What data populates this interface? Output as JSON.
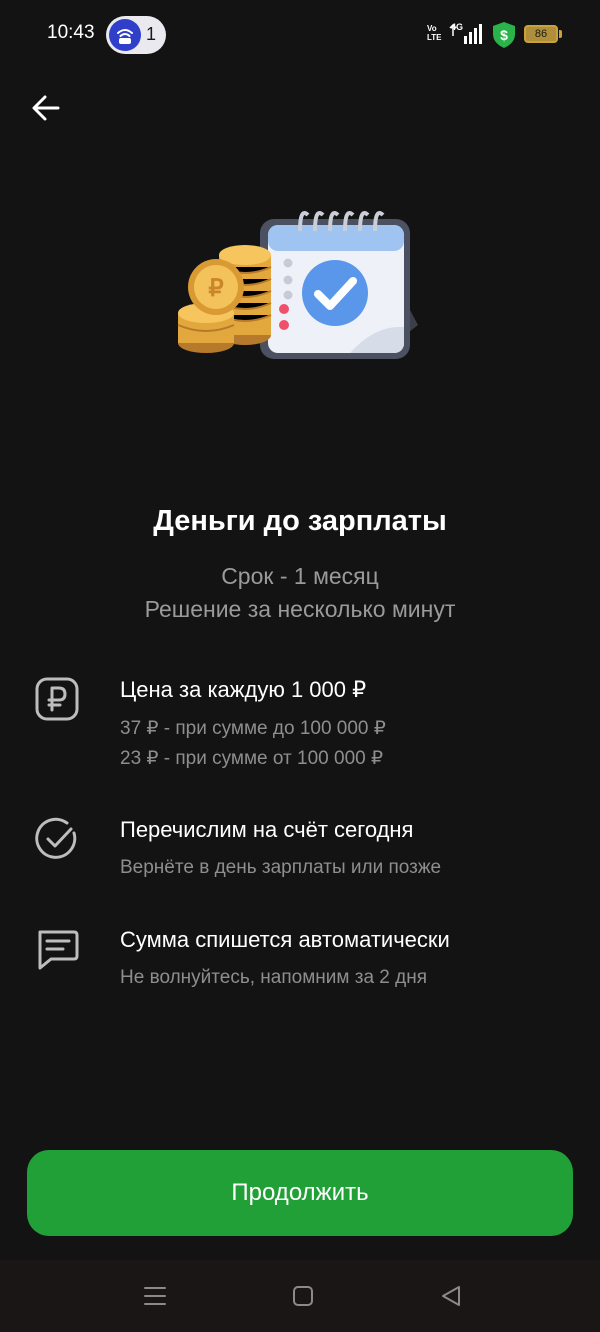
{
  "status_bar": {
    "time": "10:43",
    "vpn_count": "1",
    "volte": "Vo LTE",
    "network": "4G",
    "battery": "86"
  },
  "colors": {
    "background": "#131313",
    "accent_green": "#21a038",
    "muted_text": "#8e8e8e"
  },
  "header": {
    "back_icon": "arrow-left-icon"
  },
  "hero": {
    "illustration": "coins-and-calendar-checkmark"
  },
  "title": "Деньги до зарплаты",
  "subtitle": [
    "Срок - 1 месяц",
    "Решение за несколько минут"
  ],
  "features": [
    {
      "icon": "ruble-icon",
      "title": "Цена за каждую 1 000 ₽",
      "lines": [
        "37 ₽ - при сумме до 100 000 ₽",
        "23 ₽ - при сумме от 100 000 ₽"
      ]
    },
    {
      "icon": "check-circle-icon",
      "title": "Перечислим на счёт сегодня",
      "lines": [
        "Вернёте в день зарплаты или позже"
      ]
    },
    {
      "icon": "message-icon",
      "title": "Сумма спишется автоматически",
      "lines": [
        "Не волнуйтесь, напомним за 2 дня"
      ]
    }
  ],
  "cta": {
    "label": "Продолжить"
  },
  "nav_bar": {
    "icons": [
      "menu-icon",
      "home-icon",
      "back-triangle-icon"
    ]
  }
}
